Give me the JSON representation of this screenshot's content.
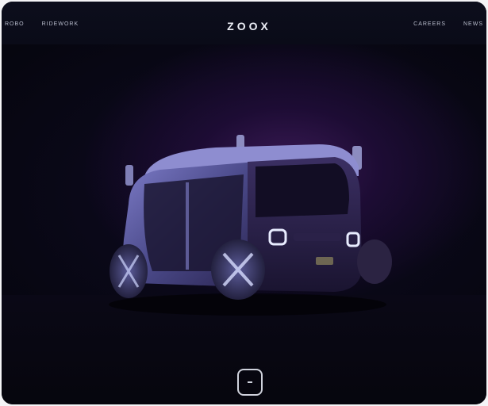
{
  "brand": {
    "logo_text": "ZOOX"
  },
  "nav": {
    "left": [
      "ROBO",
      "RIDEWORK"
    ],
    "right": [
      "CAREERS",
      "NEWS"
    ]
  },
  "hero": {
    "image": "zoox-autonomous-vehicle"
  },
  "scroll_button": {
    "icon": "scroll-down-icon"
  },
  "colors": {
    "background": "#05060d",
    "topbar": "#0b0c1a",
    "accent_glow": "#3a1a55",
    "vehicle_body": "#5b5aa0",
    "headlight": "#e8ecff"
  }
}
